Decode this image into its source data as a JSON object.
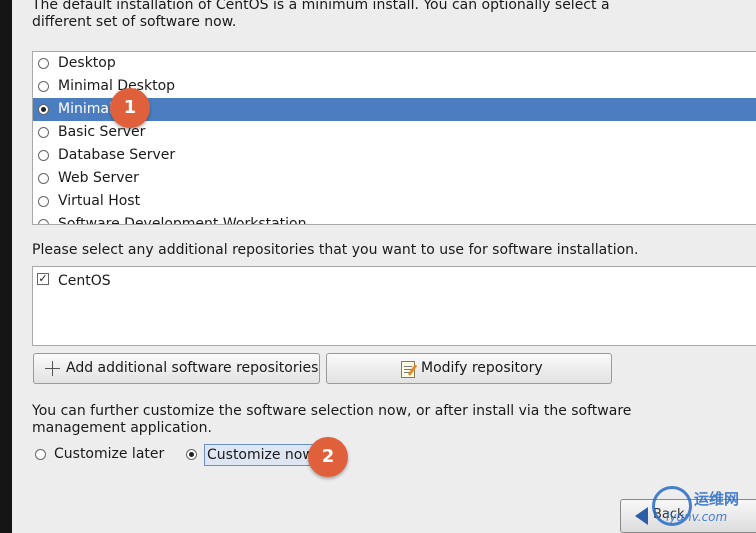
{
  "intro_text": "The default installation of CentOS is a minimum install. You can optionally select a different set of software now.",
  "software_sets": [
    {
      "label": "Desktop",
      "selected": false
    },
    {
      "label": "Minimal Desktop",
      "selected": false
    },
    {
      "label": "Minimal",
      "selected": true
    },
    {
      "label": "Basic Server",
      "selected": false
    },
    {
      "label": "Database Server",
      "selected": false
    },
    {
      "label": "Web Server",
      "selected": false
    },
    {
      "label": "Virtual Host",
      "selected": false
    },
    {
      "label": "Software Development Workstation",
      "selected": false
    }
  ],
  "repo_prompt": "Please select any additional repositories that you want to use for software installation.",
  "repositories": [
    {
      "label": "CentOS",
      "checked": true
    }
  ],
  "buttons": {
    "add_repo": "Add additional software repositories",
    "modify_repo": "Modify repository"
  },
  "customize_note": "You can further customize the software selection now, or after install via the software management application.",
  "customize_options": {
    "later": "Customize later",
    "now": "Customize now",
    "selected": "now"
  },
  "annotations": {
    "step1": "1",
    "step2": "2"
  },
  "nav": {
    "back_label": "Back"
  },
  "watermark": {
    "brand": "运维网",
    "site": "iyunv.com"
  },
  "colors": {
    "selection": "#4a7ec0",
    "badge": "#e0603c"
  }
}
